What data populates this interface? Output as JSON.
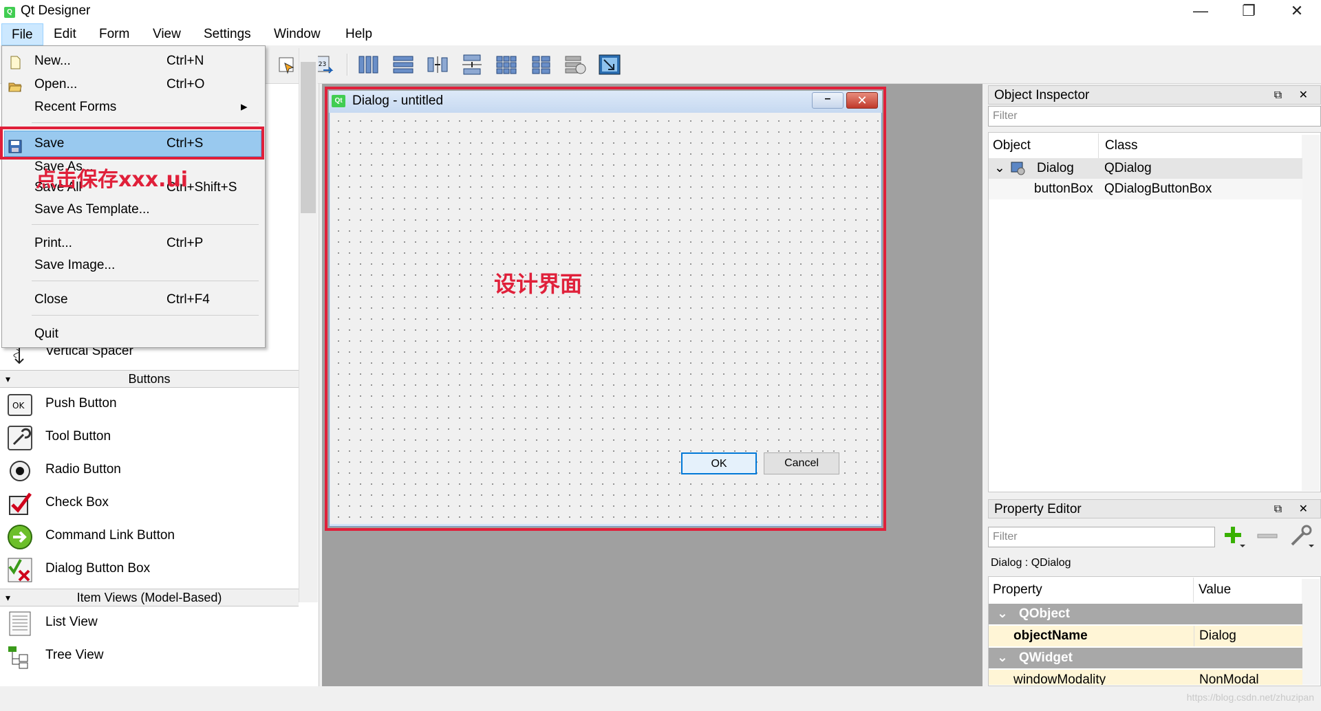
{
  "app": {
    "title": "Qt Designer",
    "icon": "Q"
  },
  "window_controls": {
    "minimize": "—",
    "maximize": "❐",
    "close": "✕"
  },
  "menubar": [
    "File",
    "Edit",
    "Form",
    "View",
    "Settings",
    "Window",
    "Help"
  ],
  "file_menu": [
    {
      "label": "New...",
      "shortcut": "Ctrl+N",
      "icon": "new-file-icon"
    },
    {
      "label": "Open...",
      "shortcut": "Ctrl+O",
      "icon": "open-folder-icon"
    },
    {
      "label": "Recent Forms",
      "shortcut": "▸"
    },
    {
      "label": "Save",
      "shortcut": "Ctrl+S",
      "icon": "save-icon"
    },
    {
      "label": "Save As...",
      "shortcut": ""
    },
    {
      "label": "Save All",
      "shortcut": "Ctrl+Shift+S"
    },
    {
      "label": "Save As Template...",
      "shortcut": ""
    },
    {
      "label": "Print...",
      "shortcut": "Ctrl+P"
    },
    {
      "label": "Save Image...",
      "shortcut": ""
    },
    {
      "label": "Close",
      "shortcut": "Ctrl+F4"
    },
    {
      "label": "Quit",
      "shortcut": ""
    }
  ],
  "annotations": {
    "save_note": "点击保存xxx.ui",
    "design_note": "设计界面"
  },
  "widget_box": {
    "spacer_item": "Vertical Spacer",
    "categories": [
      "Buttons",
      "Item Views (Model-Based)"
    ],
    "buttons": [
      "Push Button",
      "Tool Button",
      "Radio Button",
      "Check Box",
      "Command Link Button",
      "Dialog Button Box"
    ],
    "item_views": [
      "List View",
      "Tree View"
    ]
  },
  "dialog": {
    "icon": "Qt",
    "title": "Dialog - untitled",
    "ok": "OK",
    "cancel": "Cancel"
  },
  "object_inspector": {
    "title": "Object Inspector",
    "filter_placeholder": "Filter",
    "columns": [
      "Object",
      "Class"
    ],
    "rows": [
      {
        "object": "Dialog",
        "class": "QDialog"
      },
      {
        "object": "buttonBox",
        "class": "QDialogButtonBox"
      }
    ]
  },
  "property_editor": {
    "title": "Property Editor",
    "filter_placeholder": "Filter",
    "context": "Dialog : QDialog",
    "columns": [
      "Property",
      "Value"
    ],
    "groups": [
      "QObject",
      "QWidget"
    ],
    "rows": [
      {
        "property": "objectName",
        "value": "Dialog"
      },
      {
        "property": "windowModality",
        "value": "NonModal"
      }
    ]
  },
  "dock_buttons": "⧉ ✕",
  "watermark": "https://blog.csdn.net/zhuzipan",
  "colors": {
    "highlight_red": "#e0203a",
    "selection_blue": "#99c9ef",
    "qt_green": "#41cd52"
  }
}
